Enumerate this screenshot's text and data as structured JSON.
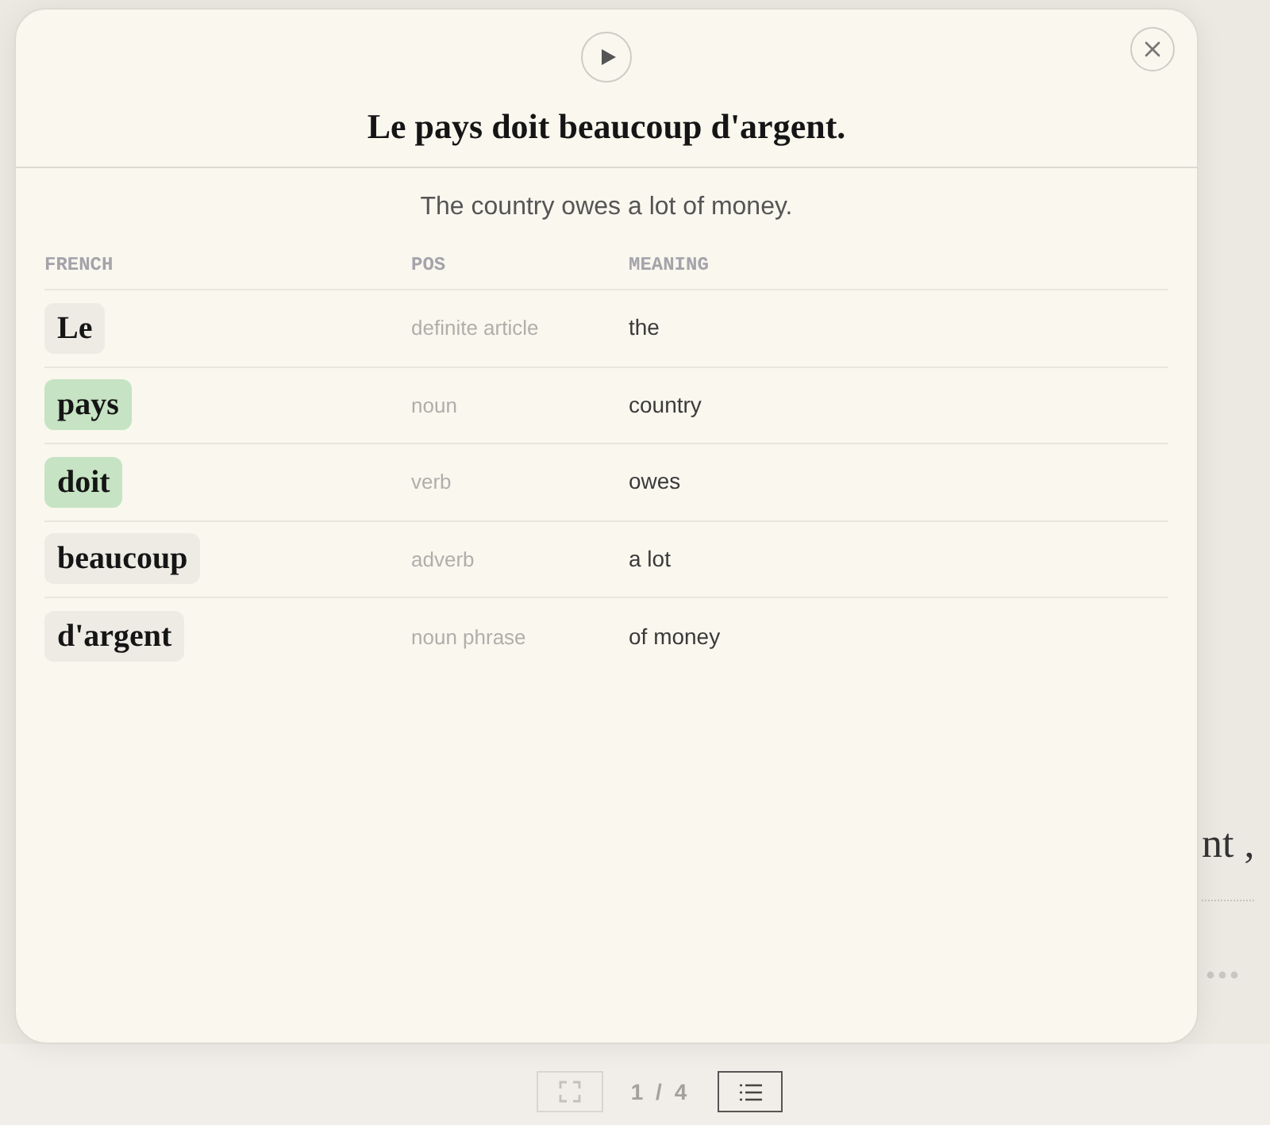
{
  "modal": {
    "title": "Le pays doit beaucoup d'argent.",
    "translation": "The country owes a lot of money.",
    "table": {
      "columns": [
        "FRENCH",
        "POS",
        "MEANING"
      ],
      "rows": [
        {
          "word": "Le",
          "highlighted": false,
          "pos": "definite article",
          "meaning": "the"
        },
        {
          "word": "pays",
          "highlighted": true,
          "pos": "noun",
          "meaning": "country"
        },
        {
          "word": "doit",
          "highlighted": true,
          "pos": "verb",
          "meaning": "owes"
        },
        {
          "word": "beaucoup",
          "highlighted": false,
          "pos": "adverb",
          "meaning": "a lot"
        },
        {
          "word": "d'argent",
          "highlighted": false,
          "pos": "noun phrase",
          "meaning": "of money"
        }
      ]
    }
  },
  "background": {
    "text_fragment": "nt ,"
  },
  "pager": {
    "fullscreen_button": {
      "selected": false
    },
    "position": "1 / 4",
    "list_button": {
      "selected": true
    }
  }
}
